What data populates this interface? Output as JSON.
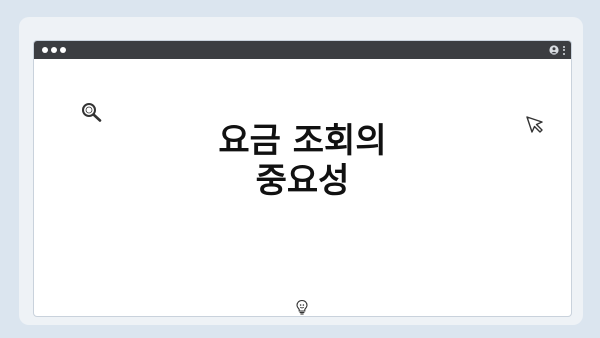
{
  "window": {
    "controls": [
      "close",
      "minimize",
      "maximize"
    ],
    "toolbar_icons": [
      "user-icon",
      "more-vertical-icon"
    ]
  },
  "main": {
    "title_line1": "요금 조회의",
    "title_line2": "중요성"
  },
  "icons": {
    "search": "search-icon",
    "cursor": "cursor-arrow-icon",
    "bulb": "lightbulb-icon"
  },
  "colors": {
    "background": "#dbe5ef",
    "titlebar": "#3b3d41",
    "window": "#ffffff",
    "text": "#111111"
  }
}
